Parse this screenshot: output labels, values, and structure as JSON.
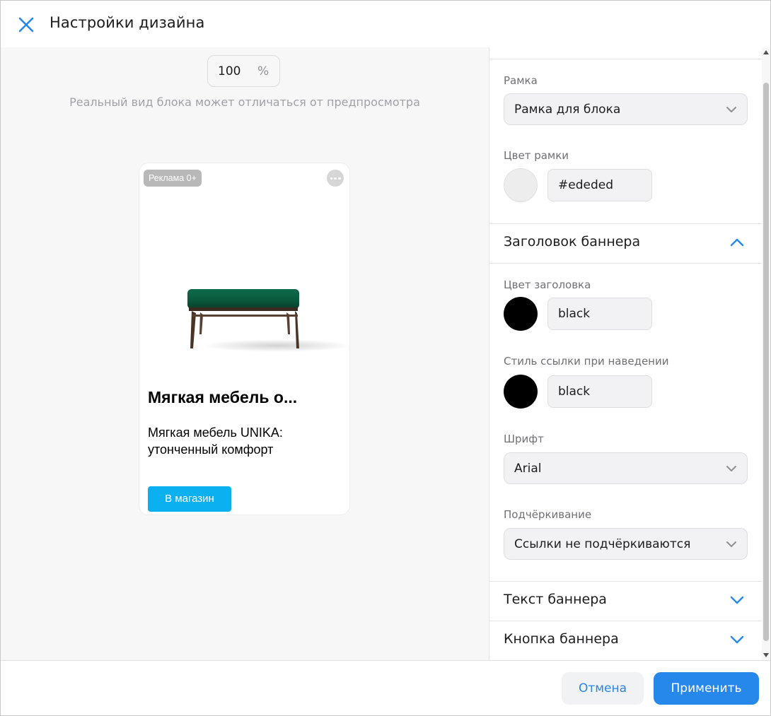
{
  "dialog": {
    "title": "Настройки дизайна",
    "close_icon": "close-icon"
  },
  "preview": {
    "zoom_value": "100",
    "zoom_unit": "%",
    "note": "Реальный вид блока может отличаться от предпросмотра",
    "banner": {
      "ad_badge": "Реклама 0+",
      "more_icon": "more-icon",
      "heading": "Мягкая мебель о...",
      "text": "Мягкая мебель UNIKA: утонченный комфорт",
      "button_label": "В магазин",
      "button_color": "#0ab0f0",
      "border_color": "#ededed"
    }
  },
  "panel": {
    "frame": {
      "label": "Рамка",
      "value": "Рамка для блока"
    },
    "frame_color": {
      "label": "Цвет рамки",
      "value": "#ededed"
    },
    "heading_section": {
      "title": "Заголовок баннера",
      "expanded": true,
      "heading_color": {
        "label": "Цвет заголовка",
        "value": "black"
      },
      "link_hover": {
        "label": "Стиль ссылки при наведении",
        "value": "black"
      },
      "font": {
        "label": "Шрифт",
        "value": "Arial"
      },
      "underline": {
        "label": "Подчёркивание",
        "value": "Ссылки не подчёркиваются"
      }
    },
    "text_section": {
      "title": "Текст баннера",
      "expanded": false
    },
    "button_section": {
      "title": "Кнопка баннера",
      "expanded": false
    }
  },
  "footer": {
    "cancel_label": "Отмена",
    "apply_label": "Применить"
  },
  "colors": {
    "accent": "#2688eb",
    "preview_bg": "#f7f7f8"
  }
}
